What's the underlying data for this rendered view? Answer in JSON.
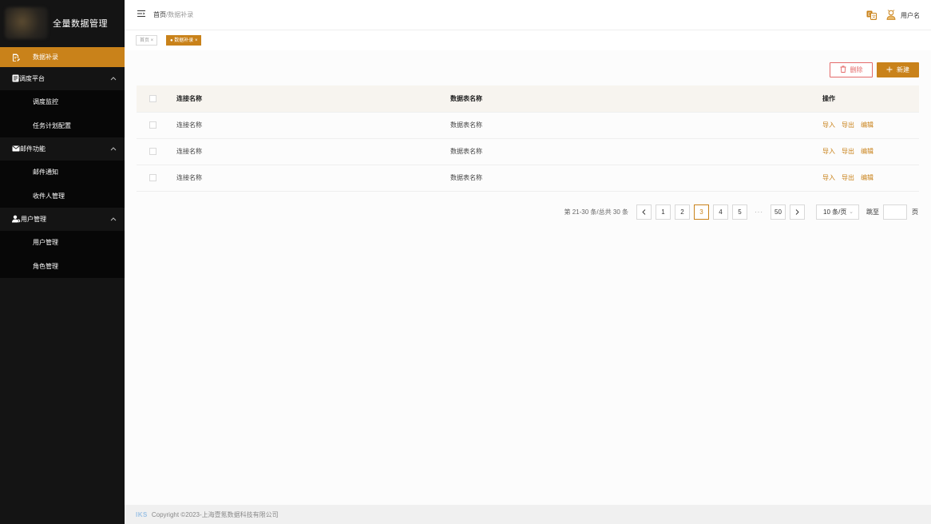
{
  "app": {
    "title": "全量数据管理"
  },
  "sidebar": {
    "items": [
      {
        "label": "数据补录",
        "icon": "file-edit-icon",
        "active": true
      },
      {
        "label": "调度平台",
        "icon": "document-icon",
        "children": [
          "调度监控",
          "任务计划配置"
        ]
      },
      {
        "label": "邮件功能",
        "icon": "mail-icon",
        "children": [
          "邮件通知",
          "收件人管理"
        ]
      },
      {
        "label": "用户管理",
        "icon": "user-settings-icon",
        "children": [
          "用户管理",
          "角色管理"
        ]
      }
    ]
  },
  "header": {
    "breadcrumb_home": "首页",
    "breadcrumb_sep": "/",
    "breadcrumb_current": "数据补录",
    "user_name": "用户名"
  },
  "tags": {
    "home": "首页 ×",
    "active": "● 数据补录 ×"
  },
  "toolbar": {
    "delete_label": "删除",
    "new_label": "新建"
  },
  "table": {
    "columns": [
      "连接名称",
      "数据表名称",
      "操作"
    ],
    "rows": [
      {
        "conn": "连接名称",
        "tbl": "数据表名称"
      },
      {
        "conn": "连接名称",
        "tbl": "数据表名称"
      },
      {
        "conn": "连接名称",
        "tbl": "数据表名称"
      }
    ],
    "actions": [
      "导入",
      "导出",
      "编辑"
    ]
  },
  "pagination": {
    "total_text": "第 21-30 条/总共 30 条",
    "pages": [
      "1",
      "2",
      "3",
      "4",
      "5",
      "···",
      "50"
    ],
    "current": "3",
    "page_size": "10 条/页",
    "jump_label": "跳至",
    "jump_suffix": "页"
  },
  "footer": {
    "logo": "IKS",
    "text": "Copyright ©2023-上海壹氪数据科技有限公司"
  },
  "colors": {
    "accent": "#c9821a",
    "danger": "#e46a6a",
    "sidebar_bg": "#141414"
  }
}
